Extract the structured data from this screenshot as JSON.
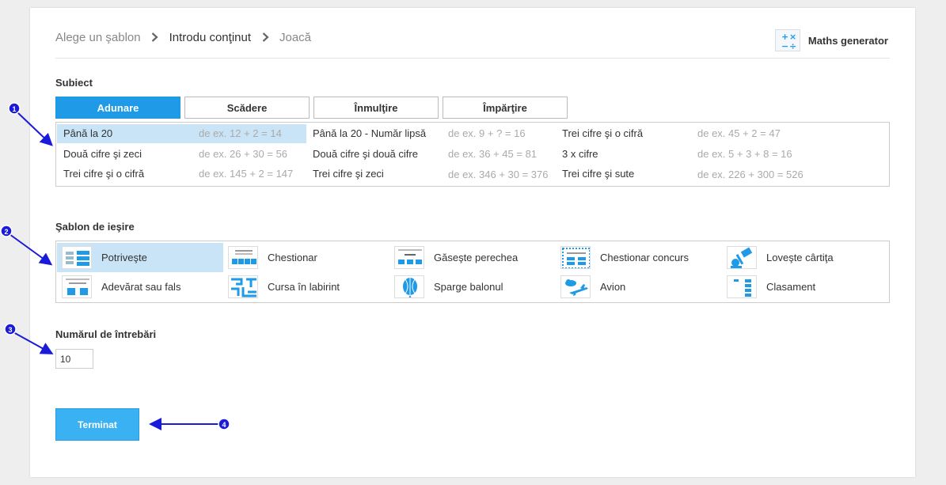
{
  "breadcrumb": {
    "step1": "Alege un şablon",
    "step2": "Introdu conţinut",
    "step3": "Joacă"
  },
  "maths_generator": {
    "label": "Maths generator",
    "icon": "maths-symbols-icon"
  },
  "subject": {
    "label": "Subiect",
    "tabs": [
      "Adunare",
      "Scădere",
      "Înmulţire",
      "Împărţire"
    ],
    "active_tab": "Adunare",
    "items": [
      {
        "name": "Până la 20",
        "example": "de ex. 12 + 2 = 14"
      },
      {
        "name": "Până la 20 - Număr lipsă",
        "example": "de ex. 9 + ? = 16"
      },
      {
        "name": "Trei cifre şi o cifră",
        "example": "de ex. 45 + 2 = 47"
      },
      {
        "name": "Două cifre şi zeci",
        "example": "de ex. 26 + 30 = 56"
      },
      {
        "name": "Două cifre şi două cifre",
        "example": "de ex. 36 + 45 = 81"
      },
      {
        "name": "3 x cifre",
        "example": "de ex. 5 + 3 + 8 = 16"
      },
      {
        "name": "Trei cifre şi o cifră",
        "example": "de ex. 145 + 2 = 147"
      },
      {
        "name": "Trei cifre şi zeci",
        "example": "de ex. 346 + 30 = 376"
      },
      {
        "name": "Trei cifre şi sute",
        "example": "de ex. 226 + 300 = 526"
      }
    ],
    "selected_item": "Până la 20"
  },
  "template": {
    "label": "Şablon de ieşire",
    "items": [
      {
        "name": "Potriveşte",
        "icon": "match-up-icon"
      },
      {
        "name": "Chestionar",
        "icon": "quiz-icon"
      },
      {
        "name": "Găseşte perechea",
        "icon": "find-match-icon"
      },
      {
        "name": "Chestionar concurs",
        "icon": "gameshow-quiz-icon"
      },
      {
        "name": "Loveşte cârtiţa",
        "icon": "whack-a-mole-icon"
      },
      {
        "name": "Adevărat sau fals",
        "icon": "true-false-icon"
      },
      {
        "name": "Cursa în labirint",
        "icon": "maze-chase-icon"
      },
      {
        "name": "Sparge balonul",
        "icon": "balloon-pop-icon"
      },
      {
        "name": "Avion",
        "icon": "airplane-icon"
      },
      {
        "name": "Clasament",
        "icon": "rank-order-icon"
      }
    ],
    "selected": "Potriveşte"
  },
  "questions": {
    "label": "Numărul de întrebări",
    "value": "10"
  },
  "finish_button": "Terminat",
  "annotations": [
    "1",
    "2",
    "3",
    "4"
  ],
  "colors": {
    "accent": "#1e9ae6",
    "selected_bg": "#c9e4f6",
    "button": "#3ab1f2",
    "annotation": "#1a1adb"
  }
}
